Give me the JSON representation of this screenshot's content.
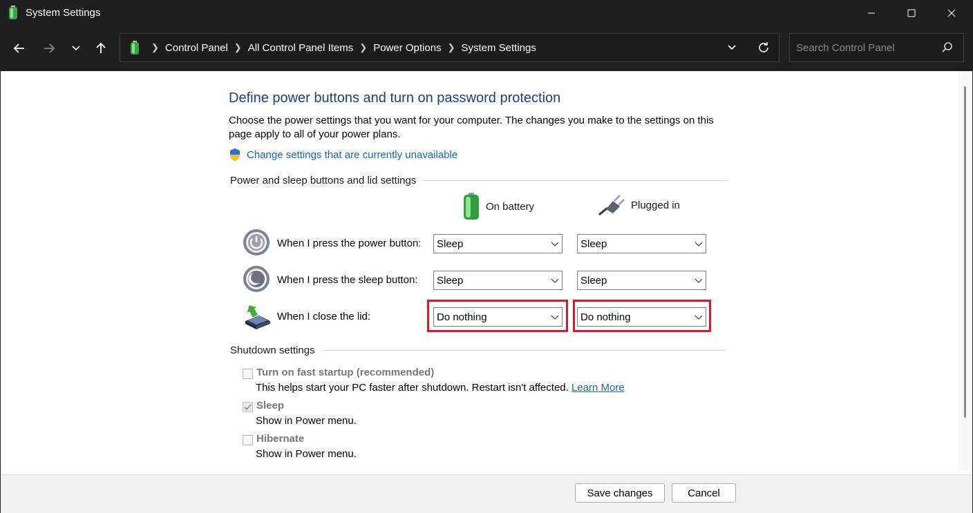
{
  "window": {
    "title": "System Settings"
  },
  "breadcrumb": {
    "items": [
      "Control Panel",
      "All Control Panel Items",
      "Power Options",
      "System Settings"
    ]
  },
  "search": {
    "placeholder": "Search Control Panel"
  },
  "page": {
    "heading": "Define power buttons and turn on password protection",
    "intro": "Choose the power settings that you want for your computer. The changes you make to the settings on this page apply to all of your power plans.",
    "change_link": "Change settings that are currently unavailable"
  },
  "buttons_section": {
    "title": "Power and sleep buttons and lid settings",
    "columns": {
      "battery": "On battery",
      "plugged": "Plugged in"
    },
    "rows": [
      {
        "label": "When I press the power button:",
        "battery": "Sleep",
        "plugged": "Sleep"
      },
      {
        "label": "When I press the sleep button:",
        "battery": "Sleep",
        "plugged": "Sleep"
      },
      {
        "label": "When I close the lid:",
        "battery": "Do nothing",
        "plugged": "Do nothing"
      }
    ]
  },
  "shutdown_section": {
    "title": "Shutdown settings",
    "options": [
      {
        "label": "Turn on fast startup (recommended)",
        "desc": "This helps start your PC faster after shutdown. Restart isn't affected.",
        "link": "Learn More",
        "checked": false
      },
      {
        "label": "Sleep",
        "desc": "Show in Power menu.",
        "checked": true
      },
      {
        "label": "Hibernate",
        "desc": "Show in Power menu.",
        "checked": false
      }
    ]
  },
  "footer": {
    "save": "Save changes",
    "cancel": "Cancel"
  },
  "colors": {
    "highlight": "#d01c2b",
    "link": "#1565c0",
    "heading": "#1c3c8c"
  }
}
